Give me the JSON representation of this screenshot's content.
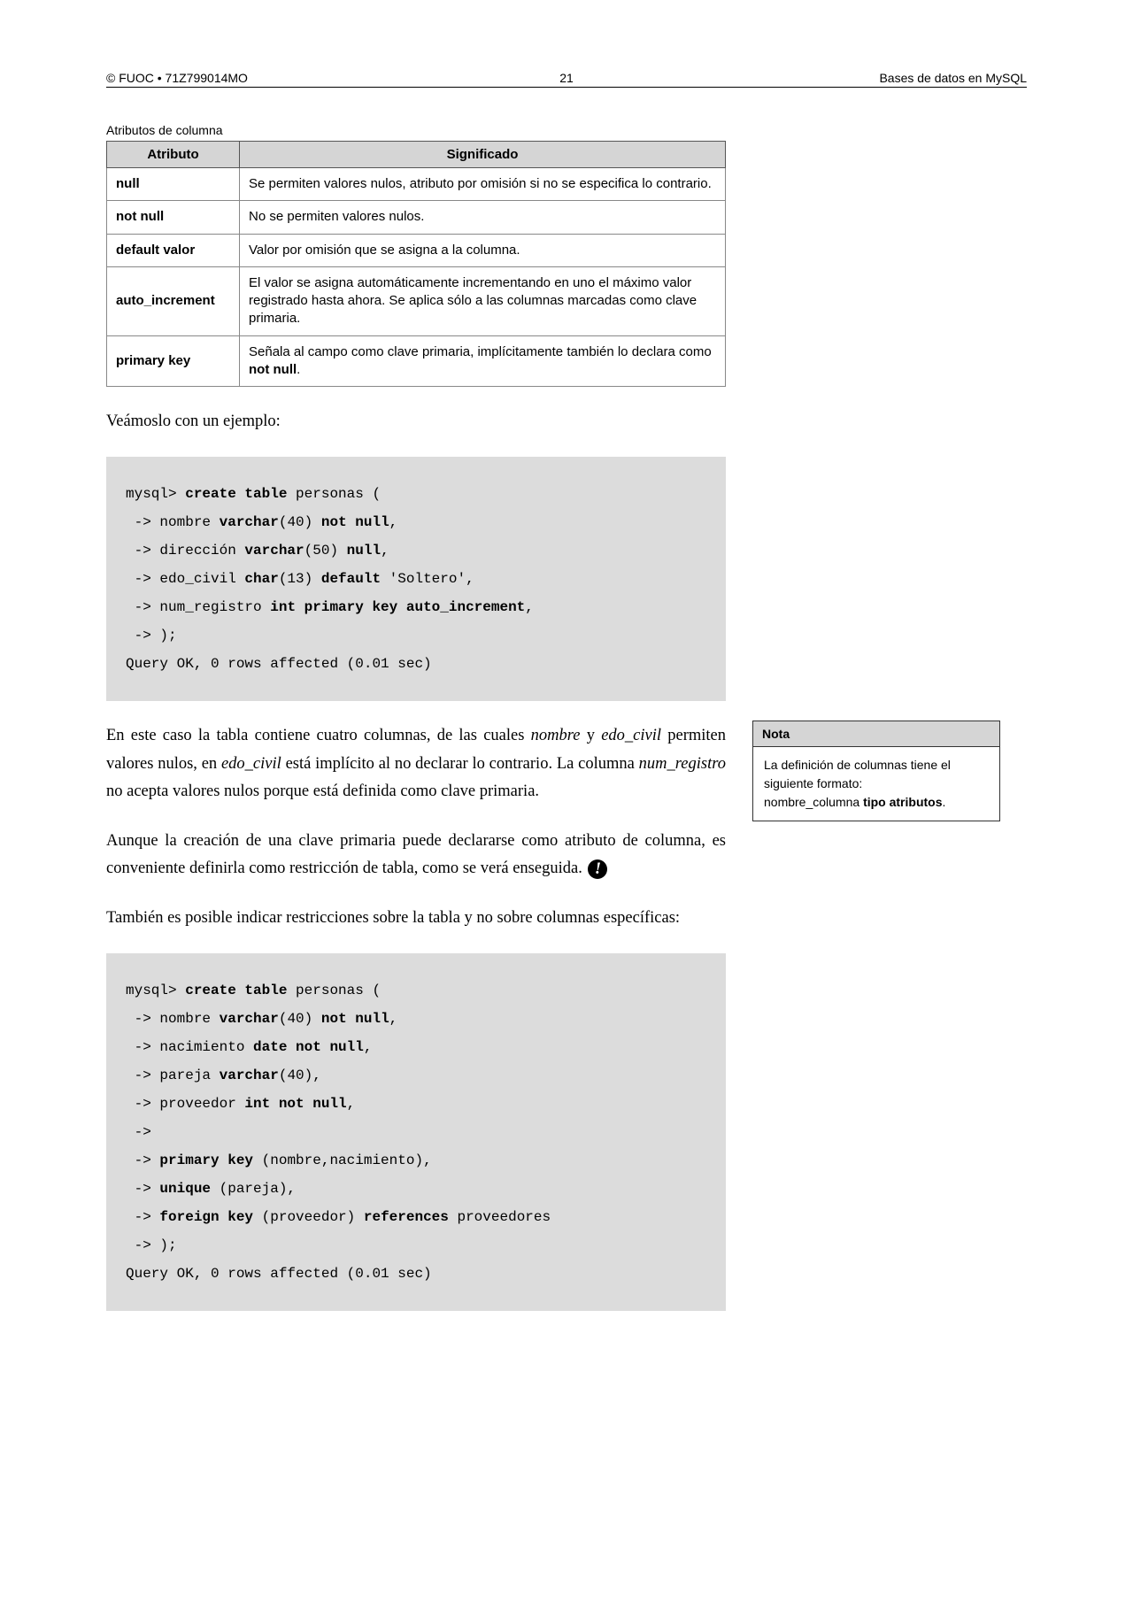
{
  "header": {
    "left": "© FUOC • 71Z799014MO",
    "center": "21",
    "right": "Bases de datos en MySQL"
  },
  "table": {
    "caption": "Atributos de columna",
    "col1": "Atributo",
    "col2": "Significado",
    "rows": [
      {
        "name": "null",
        "desc": "Se permiten valores nulos, atributo por omisión si no se especifica lo contrario."
      },
      {
        "name": "not null",
        "desc": "No se permiten valores nulos."
      },
      {
        "name": "default valor",
        "desc": "Valor por omisión que se asigna a la columna."
      },
      {
        "name": "auto_increment",
        "desc": "El valor se asigna automáticamente incrementando en uno el máximo valor registrado hasta ahora. Se aplica sólo a las columnas marcadas como clave primaria."
      },
      {
        "name": "primary key",
        "desc_pre": "Señala al campo como clave primaria, implícitamente también lo declara como ",
        "desc_bold": "not null",
        "desc_post": "."
      }
    ]
  },
  "para1": "Veámoslo con un ejemplo:",
  "code1": {
    "l1a": "mysql> ",
    "l1b": "create table",
    "l1c": " personas (",
    "l2a": " -> nombre ",
    "l2b": "varchar",
    "l2c": "(40) ",
    "l2d": "not null",
    "l2e": ",",
    "l3a": " -> dirección ",
    "l3b": "varchar",
    "l3c": "(50) ",
    "l3d": "null",
    "l3e": ",",
    "l4a": " -> edo_civil ",
    "l4b": "char",
    "l4c": "(13) ",
    "l4d": "default",
    "l4e": " 'Soltero',",
    "l5a": " -> num_registro ",
    "l5b": "int primary key auto_increment",
    "l5c": ",",
    "l6": " -> );",
    "l7": "Query OK, 0 rows affected (0.01 sec)"
  },
  "para2": {
    "t1": "En este caso la tabla contiene cuatro columnas, de las cuales ",
    "i1": "nombre",
    "t2": " y ",
    "i2": "edo_civil",
    "t3": " permiten valores nulos, en ",
    "i3": "edo_civil",
    "t4": " está implícito al no declarar lo contrario. La columna ",
    "i4": "num_registro",
    "t5": " no acepta valores nulos porque está definida como clave primaria."
  },
  "para3": "Aunque la creación de una clave primaria puede declararse como atributo de columna, es conveniente definirla como restricción de tabla, como se verá enseguida.",
  "para4": "También es posible indicar restricciones sobre la tabla y no sobre columnas específicas:",
  "code2": {
    "l1a": "mysql> ",
    "l1b": "create table",
    "l1c": " personas (",
    "l2a": " -> nombre ",
    "l2b": "varchar",
    "l2c": "(40) ",
    "l2d": "not null",
    "l2e": ",",
    "l3a": " -> nacimiento ",
    "l3b": "date not null",
    "l3c": ",",
    "l4a": " -> pareja ",
    "l4b": "varchar",
    "l4c": "(40),",
    "l5a": " -> proveedor ",
    "l5b": "int not null",
    "l5c": ",",
    "l6": " ->",
    "l7a": " -> ",
    "l7b": "primary key",
    "l7c": " (nombre,nacimiento),",
    "l8a": " -> ",
    "l8b": "unique",
    "l8c": " (pareja),",
    "l9a": " -> ",
    "l9b": "foreign key",
    "l9c": " (proveedor) ",
    "l9d": "references",
    "l9e": " proveedores",
    "l10": " -> );",
    "l11": "Query OK, 0 rows affected (0.01 sec)"
  },
  "note": {
    "head": "Nota",
    "line1": "La definición de columnas tiene el siguiente formato:",
    "line2a": "nombre_columna ",
    "line2b": "tipo atributos",
    "line2c": "."
  },
  "icon_glyph": "!"
}
